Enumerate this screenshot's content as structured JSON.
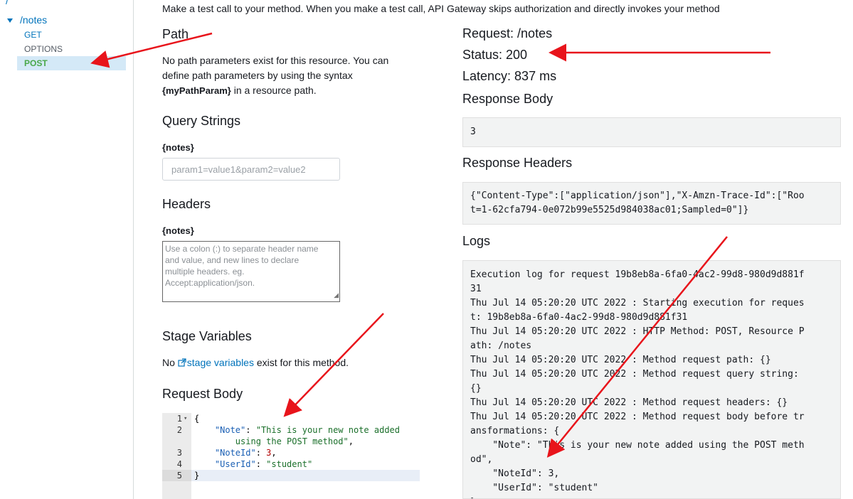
{
  "sidebar": {
    "root": "/",
    "resource": "/notes",
    "methods": [
      "GET",
      "OPTIONS",
      "POST"
    ]
  },
  "intro": "Make a test call to your method. When you make a test call, API Gateway skips authorization and directly invokes your method",
  "path": {
    "title": "Path",
    "line1": "No path parameters exist for this resource. You can",
    "line2": "define path parameters by using the syntax",
    "syntax": "{myPathParam}",
    "line3_suffix": " in a resource path."
  },
  "query": {
    "title": "Query Strings",
    "label": "{notes}",
    "placeholder": "param1=value1&param2=value2"
  },
  "headers": {
    "title": "Headers",
    "label": "{notes}",
    "placeholder_lines": [
      "Use a colon (:) to separate header name",
      "and value, and new lines to declare",
      "multiple headers. eg.",
      "Accept:application/json."
    ]
  },
  "stage": {
    "title": "Stage Variables",
    "prefix": "No ",
    "link": "stage variables",
    "suffix": " exist for this method."
  },
  "request_body": {
    "title": "Request Body",
    "line_numbers": [
      "1",
      "2",
      "3",
      "4",
      "5"
    ],
    "brace_open": "{",
    "brace_close": "}",
    "note_key": "\"Note\"",
    "note_val_1": "\"This is your new note added",
    "note_val_2": "using the POST method\"",
    "noteid_key": "\"NoteId\"",
    "noteid_val": "3",
    "userid_key": "\"UserId\"",
    "userid_val": "\"student\""
  },
  "result": {
    "request": "Request: /notes",
    "status": "Status: 200",
    "latency": "Latency: 837 ms",
    "response_body_label": "Response Body",
    "response_body": "3",
    "response_headers_label": "Response Headers",
    "response_headers": "{\"Content-Type\":[\"application/json\"],\"X-Amzn-Trace-Id\":[\"Roo\nt=1-62cfa794-0e072b99e5525d984038ac01;Sampled=0\"]}",
    "logs_label": "Logs",
    "logs": "Execution log for request 19b8eb8a-6fa0-4ac2-99d8-980d9d881f\n31\nThu Jul 14 05:20:20 UTC 2022 : Starting execution for reques\nt: 19b8eb8a-6fa0-4ac2-99d8-980d9d881f31\nThu Jul 14 05:20:20 UTC 2022 : HTTP Method: POST, Resource P\nath: /notes\nThu Jul 14 05:20:20 UTC 2022 : Method request path: {}\nThu Jul 14 05:20:20 UTC 2022 : Method request query string:\n{}\nThu Jul 14 05:20:20 UTC 2022 : Method request headers: {}\nThu Jul 14 05:20:20 UTC 2022 : Method request body before tr\nansformations: {\n    \"Note\": \"This is your new note added using the POST meth\nod\",\n    \"NoteId\": 3,\n    \"UserId\": \"student\"\n}"
  },
  "colors": {
    "link": "#0073bb",
    "selected_bg": "#d4e9f7",
    "post_green": "#4aa84a",
    "arrow_red": "#e8141b"
  }
}
